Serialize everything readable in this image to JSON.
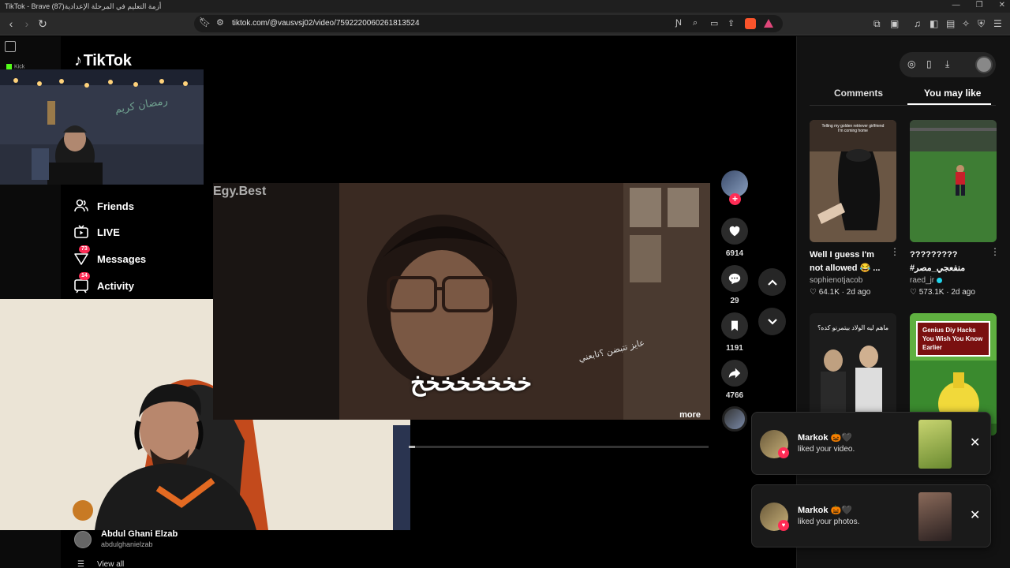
{
  "browser": {
    "window_title": "TikTok - Brave (87)أزمة التعليم في المرحلة الإعدادية",
    "url": "tiktok.com/@vausvsj02/video/7592220060261813524"
  },
  "sidebar": {
    "logo": "TikTok",
    "kick_label": "Kick",
    "items": [
      {
        "label": "Friends",
        "badge": ""
      },
      {
        "label": "LIVE",
        "badge": ""
      },
      {
        "label": "Messages",
        "badge": "73"
      },
      {
        "label": "Activity",
        "badge": "14"
      }
    ],
    "account": {
      "name": "Abdul Ghani Elzab",
      "handle": "abdulghanielzab"
    },
    "view_all": "View all"
  },
  "video": {
    "watermark": "Egy.Best",
    "caption_small": "عايز تتبضن ؟تابعني",
    "caption_big": "خخخخخخخخ",
    "more_label": "more",
    "progress_fraction": 0.02
  },
  "actions": {
    "likes": "6914",
    "comments": "29",
    "saves": "1191",
    "shares": "4766"
  },
  "right_panel": {
    "tabs": [
      "Comments",
      "You may like"
    ],
    "active_tab": "You may like",
    "cards": [
      {
        "title": "Well I guess I'm not allowed 😂 ...",
        "author": "sophienotjacob",
        "likes": "64.1K",
        "age": "2d ago",
        "verified": false,
        "thumb_text": "Telling my golden retriever girlfriend I'm coming home"
      },
      {
        "title": "?????????  #منفعجي_مصر",
        "author": "raed_jr",
        "likes": "573.1K",
        "age": "2d ago",
        "verified": true,
        "thumb_text": ""
      },
      {
        "title": "",
        "author": "",
        "likes": "",
        "age": "",
        "verified": false,
        "thumb_text": "ماهم ليه الولاد بيتمرنو كده؟"
      },
      {
        "title": "",
        "author": "",
        "likes": "",
        "age": "",
        "verified": false,
        "thumb_text": "Genius Diy Hacks You Wish You Know Earlier"
      }
    ]
  },
  "notifications": [
    {
      "name": "Markok 🎃🖤",
      "message": "liked your video."
    },
    {
      "name": "Markok 🎃🖤",
      "message": "liked your photos."
    }
  ],
  "colors": {
    "accent": "#fe2c55",
    "verified": "#20d5ec"
  }
}
